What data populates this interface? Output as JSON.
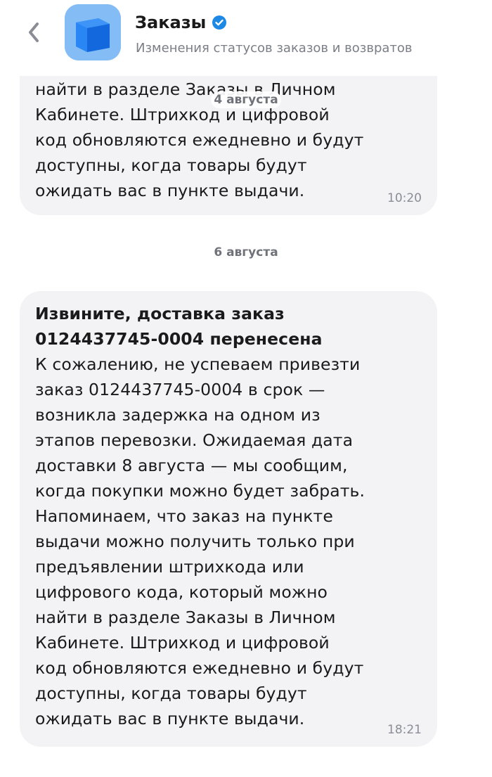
{
  "header": {
    "title": "Заказы",
    "subtitle": "Изменения статусов заказов и возвратов",
    "back_icon": "chevron-left-icon",
    "app_icon": "blue-box-icon",
    "verified_icon": "verified-check-icon",
    "accent_color": "#1e88e5"
  },
  "messages": [
    {
      "date": "4 августа",
      "title": "",
      "body": "найти в разделе Заказы в Личном\nКабинете. Штрихкод и цифровой\nкод обновляются ежедневно и будут\nдоступны, когда товары будут\nожидать вас в пункте выдачи.",
      "time": "10:20"
    },
    {
      "date": "6 августа",
      "title": "Извините, доставка заказ\n0124437745-0004 перенесена",
      "body": "К сожалению, не успеваем привезти\nзаказ 0124437745-0004 в срок —\nвозникла задержка на одном из\nэтапов перевозки. Ожидаемая дата\nдоставки 8 августа — мы сообщим,\nкогда покупки можно будет забрать.\nНапоминаем, что заказ на пункте\nвыдачи можно получить только при\nпредъявлении штрихкода или\nцифрового кода, который можно\nнайти в разделе Заказы в Личном\nКабинете. Штрихкод и цифровой\nкод обновляются ежедневно и будут\nдоступны, когда товары будут\nожидать вас в пункте выдачи.",
      "time": "18:21"
    }
  ]
}
